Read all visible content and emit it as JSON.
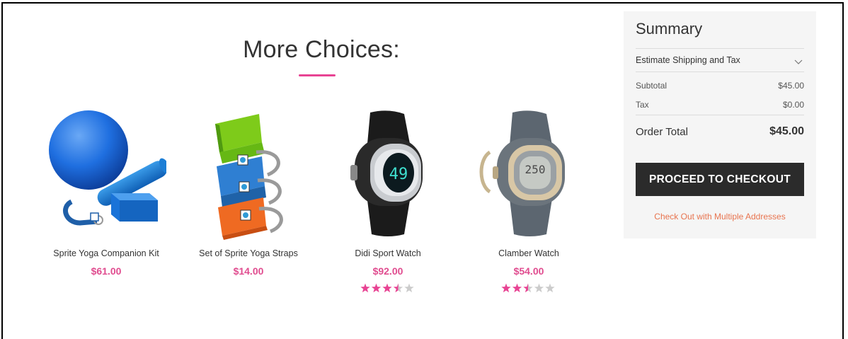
{
  "more_choices": {
    "title": "More Choices:",
    "accent": "#e84393",
    "products": [
      {
        "name": "Sprite Yoga Companion Kit",
        "price": "$61.00",
        "image": "yoga-kit-image",
        "rating": null
      },
      {
        "name": "Set of Sprite Yoga Straps",
        "price": "$14.00",
        "image": "yoga-straps-image",
        "rating": null
      },
      {
        "name": "Didi Sport Watch",
        "price": "$92.00",
        "image": "sport-watch-image",
        "rating": 3.5
      },
      {
        "name": "Clamber Watch",
        "price": "$54.00",
        "image": "clamber-watch-image",
        "rating": 2.5
      }
    ]
  },
  "summary": {
    "title": "Summary",
    "estimate_label": "Estimate Shipping and Tax",
    "subtotal_label": "Subtotal",
    "subtotal_value": "$45.00",
    "tax_label": "Tax",
    "tax_value": "$0.00",
    "order_total_label": "Order Total",
    "order_total_value": "$45.00",
    "checkout_label": "PROCEED TO CHECKOUT",
    "multi_address_label": "Check Out with Multiple Addresses",
    "link_color": "#e8744f"
  }
}
